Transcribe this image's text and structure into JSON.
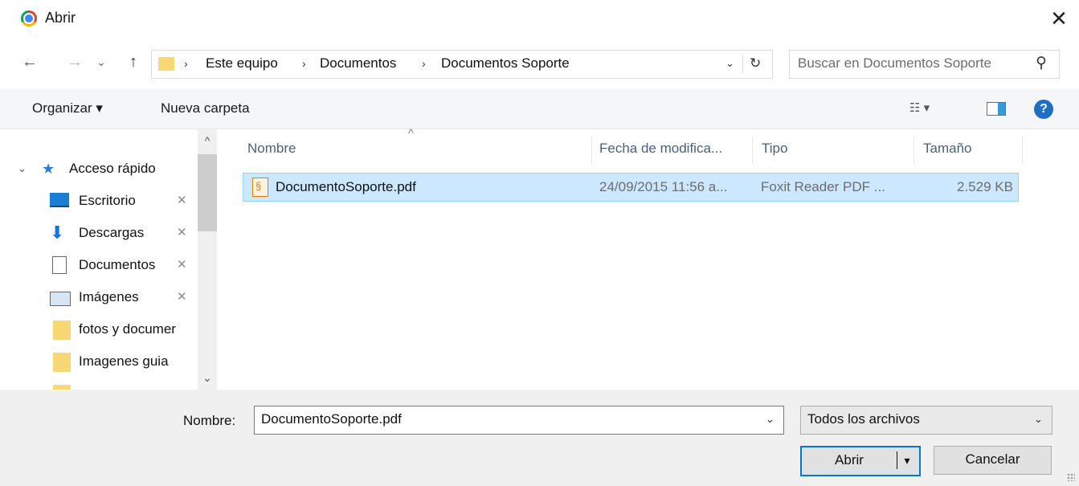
{
  "window": {
    "title": "Abrir",
    "close_glyph": "✕"
  },
  "nav": {
    "back": "←",
    "forward": "→",
    "recent": "⌄",
    "up": "↑"
  },
  "address": {
    "crumbs": [
      "Este equipo",
      "Documentos",
      "Documentos Soporte"
    ],
    "sep": "›",
    "dropdown": "⌄",
    "refresh": "↻"
  },
  "search": {
    "placeholder": "Buscar en Documentos Soporte",
    "icon": "⚲"
  },
  "toolbar": {
    "organize_label": "Organizar ▾",
    "new_folder_label": "Nueva carpeta",
    "view_glyph": "☷ ▾",
    "help_glyph": "?"
  },
  "sidebar": {
    "quick_access": "Acceso rápido",
    "items": [
      {
        "label": "Escritorio",
        "pin": "📌"
      },
      {
        "label": "Descargas",
        "pin": "📌"
      },
      {
        "label": "Documentos",
        "pin": "📌"
      },
      {
        "label": "Imágenes",
        "pin": "📌"
      },
      {
        "label": "fotos y documer"
      },
      {
        "label": "Imagenes guia"
      }
    ],
    "scroll_up": "^",
    "scroll_down": "⌄",
    "expand_glyph": "⌄"
  },
  "columns": {
    "sort_indicator": "^",
    "name": "Nombre",
    "date": "Fecha de modifica...",
    "type": "Tipo",
    "size": "Tamaño"
  },
  "files": [
    {
      "name": "DocumentoSoporte.pdf",
      "date": "24/09/2015 11:56 a...",
      "type": "Foxit Reader PDF ...",
      "size": "2.529 KB"
    }
  ],
  "bottom": {
    "filename_label": "Nombre:",
    "filename_value": "DocumentoSoporte.pdf",
    "filter_value": "Todos los archivos",
    "open_label": "Abrir",
    "open_arrow": "▾",
    "cancel_label": "Cancelar",
    "dropdown": "⌄"
  },
  "colors": {
    "accent": "#0078d7",
    "selection": "#cce8ff",
    "folder": "#f8d775"
  }
}
